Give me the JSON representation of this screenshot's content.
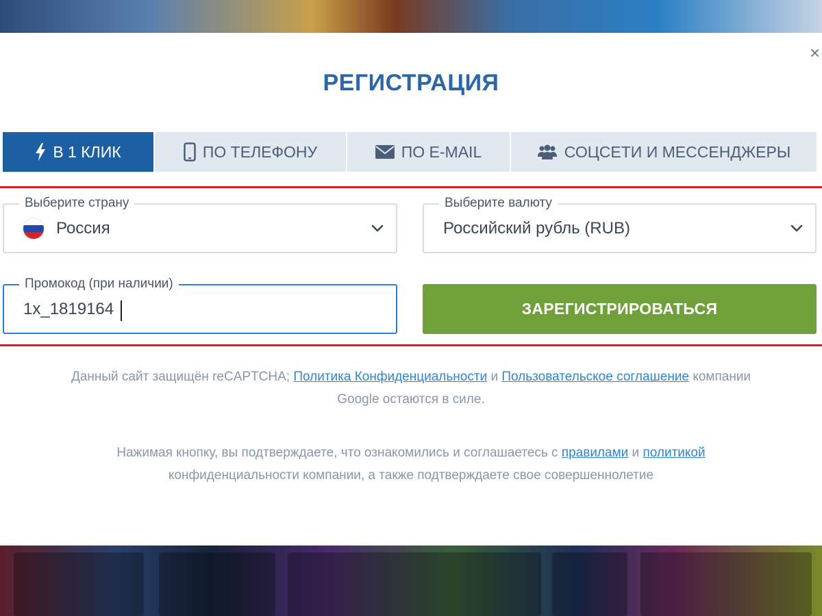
{
  "modal": {
    "title": "РЕГИСТРАЦИЯ",
    "close_glyph": "×"
  },
  "tabs": [
    {
      "label": "В 1 КЛИК",
      "icon": "lightning-icon",
      "active": true
    },
    {
      "label": "ПО ТЕЛЕФОНУ",
      "icon": "phone-icon",
      "active": false
    },
    {
      "label": "ПО E-MAIL",
      "icon": "envelope-icon",
      "active": false
    },
    {
      "label": "СОЦСЕТИ И МЕССЕНДЖЕРЫ",
      "icon": "users-icon",
      "active": false
    }
  ],
  "form": {
    "country": {
      "label": "Выберите страну",
      "value": "Россия",
      "flag": "russia-flag-icon"
    },
    "currency": {
      "label": "Выберите валюту",
      "value": "Российский рубль (RUB)"
    },
    "promo": {
      "label": "Промокод (при наличии)",
      "value": "1x_1819164"
    },
    "submit_label": "ЗАРЕГИСТРИРОВАТЬСЯ"
  },
  "recaptcha_note": {
    "prefix": "Данный сайт защищён reCAPTCHA;",
    "privacy_link": "Политика Конфиденциальности",
    "and": "и",
    "terms_link": "Пользовательское соглашение",
    "suffix_line1": "компании",
    "line2": "Google остаются в силе."
  },
  "consent_note": {
    "prefix": "Нажимая кнопку, вы подтверждаете, что ознакомились и соглашаетесь с",
    "rules_link": "правилами",
    "and": "и",
    "policy_link": "политикой",
    "line2": "конфиденциальности компании, а также подтверждаете свое совершеннолетие"
  },
  "colors": {
    "accent_blue": "#1d5fa3",
    "title_blue": "#2b67a6",
    "submit_green": "#6fa03a",
    "highlight_red": "#e01e1e",
    "link_blue": "#2f85d0"
  }
}
